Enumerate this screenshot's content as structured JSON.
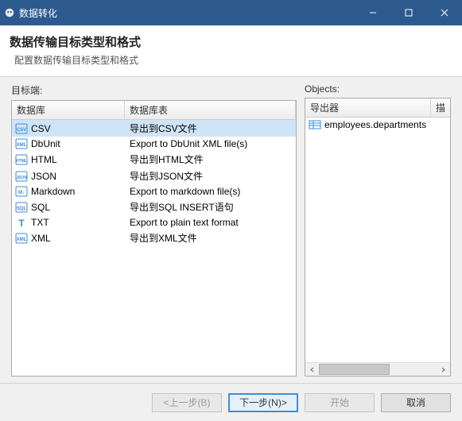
{
  "window": {
    "title": "数据转化"
  },
  "header": {
    "title": "数据传输目标类型和格式",
    "subtitle": "配置数据传输目标类型和格式"
  },
  "left": {
    "label": "目标端:",
    "columns": [
      "数据库",
      "数据库表"
    ],
    "rows": [
      {
        "name": "CSV",
        "desc": "导出到CSV文件",
        "selected": true,
        "icon": "csv"
      },
      {
        "name": "DbUnit",
        "desc": "Export to DbUnit XML file(s)",
        "icon": "xml"
      },
      {
        "name": "HTML",
        "desc": "导出到HTML文件",
        "icon": "html"
      },
      {
        "name": "JSON",
        "desc": "导出到JSON文件",
        "icon": "json"
      },
      {
        "name": "Markdown",
        "desc": "Export to markdown file(s)",
        "icon": "md"
      },
      {
        "name": "SQL",
        "desc": "导出到SQL INSERT语句",
        "icon": "sql"
      },
      {
        "name": "TXT",
        "desc": "Export to plain text format",
        "icon": "txt"
      },
      {
        "name": "XML",
        "desc": "导出到XML文件",
        "icon": "xml"
      }
    ]
  },
  "right": {
    "label": "Objects:",
    "columns": [
      "导出器",
      "描"
    ],
    "rows": [
      {
        "name": "employees.departments",
        "icon": "table"
      }
    ]
  },
  "footer": {
    "back": "<上一步(B)",
    "next": "下一步(N)>",
    "start": "开始",
    "cancel": "取消"
  }
}
